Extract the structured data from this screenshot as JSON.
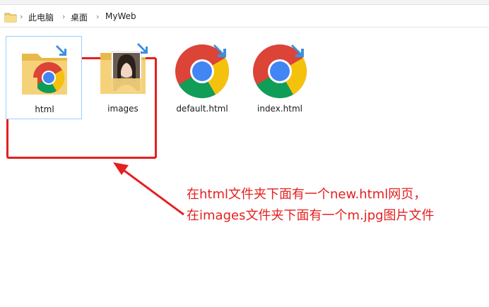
{
  "breadcrumb": {
    "items": [
      "此电脑",
      "桌面",
      "MyWeb"
    ],
    "separator": "›"
  },
  "files": [
    {
      "name": "html",
      "kind": "folder-with-chrome-icon",
      "selected": true
    },
    {
      "name": "images",
      "kind": "folder-with-photo-icon",
      "selected": false
    },
    {
      "name": "default.html",
      "kind": "chrome-html-file-icon",
      "selected": false
    },
    {
      "name": "index.html",
      "kind": "chrome-html-file-icon",
      "selected": false
    }
  ],
  "annotation": {
    "line1": "在html文件夹下面有一个new.html网页，",
    "line2": "在images文件夹下面有一个m.jpg图片文件",
    "color": "#e42020"
  },
  "colors": {
    "highlight_box": "#e42020",
    "selection_border": "#99d1ff",
    "folder_yellow": "#f2cf73",
    "shortcut_arrow": "#3c8fe0"
  }
}
